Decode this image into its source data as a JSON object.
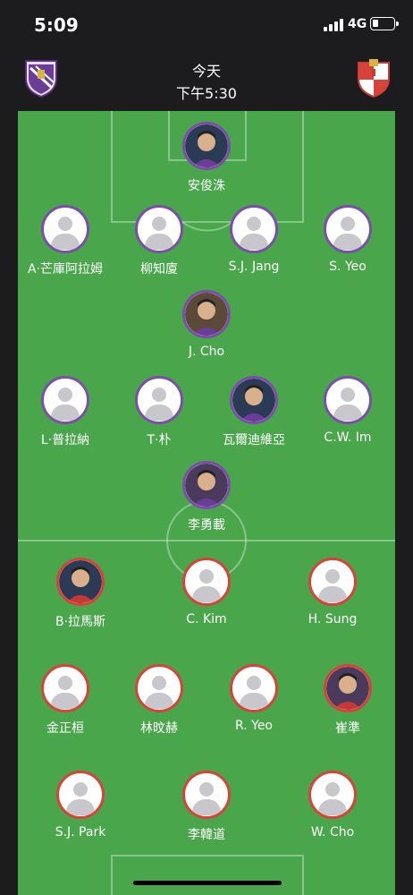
{
  "status_bar": {
    "time": "5:09",
    "network": "4G"
  },
  "header": {
    "day": "今天",
    "time": "下午5:30",
    "home_crest_icon": "home-team-crest-icon",
    "away_crest_icon": "away-team-crest-icon"
  },
  "colors": {
    "home_ring": "#7b4fa8",
    "away_ring": "#d9423a",
    "pitch": "#49a64a"
  },
  "home_players": [
    {
      "name": "安俊洙",
      "photo": true
    },
    {
      "name": "A·芒庫阿拉姆",
      "photo": false
    },
    {
      "name": "柳知廈",
      "photo": false
    },
    {
      "name": "S.J. Jang",
      "photo": false
    },
    {
      "name": "S. Yeo",
      "photo": false
    },
    {
      "name": "J. Cho",
      "photo": true
    },
    {
      "name": "L·普拉納",
      "photo": false
    },
    {
      "name": "T·朴",
      "photo": false
    },
    {
      "name": "瓦爾迪維亞",
      "photo": true
    },
    {
      "name": "C.W. Im",
      "photo": false
    },
    {
      "name": "李勇載",
      "photo": true
    }
  ],
  "away_players": [
    {
      "name": "B·拉馬斯",
      "photo": true
    },
    {
      "name": "C. Kim",
      "photo": false
    },
    {
      "name": "H. Sung",
      "photo": false
    },
    {
      "name": "金正桓",
      "photo": false
    },
    {
      "name": "林旼赫",
      "photo": false
    },
    {
      "name": "R. Yeo",
      "photo": false
    },
    {
      "name": "崔準",
      "photo": true
    },
    {
      "name": "S.J. Park",
      "photo": false
    },
    {
      "name": "李韓道",
      "photo": false
    },
    {
      "name": "W. Cho",
      "photo": false
    }
  ]
}
